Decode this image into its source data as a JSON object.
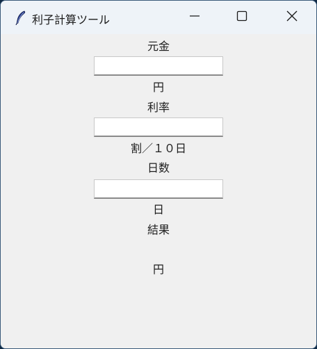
{
  "window": {
    "title": "利子計算ツール"
  },
  "form": {
    "principal_label": "元金",
    "principal_value": "",
    "principal_unit": "円",
    "rate_label": "利率",
    "rate_value": "",
    "rate_unit": "割／１０日",
    "days_label": "日数",
    "days_value": "",
    "days_unit": "日",
    "result_label": "結果",
    "result_value": "",
    "result_unit": "円"
  },
  "icons": {
    "app": "feather-icon",
    "minimize": "minimize-icon",
    "maximize": "maximize-icon",
    "close": "close-icon"
  }
}
